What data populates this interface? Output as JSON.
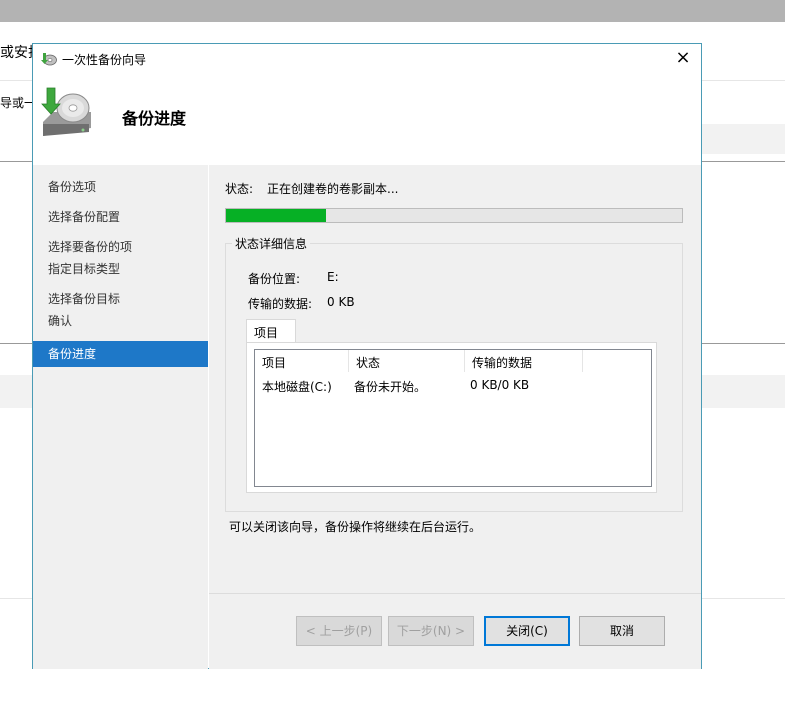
{
  "background": {
    "text1": "或安抖",
    "text2": "导或一"
  },
  "dialog": {
    "window_title": "一次性备份向导",
    "close_glyph": "×",
    "header_title": "备份进度"
  },
  "sidebar": {
    "items": [
      {
        "label": "备份选项"
      },
      {
        "label": "选择备份配置"
      },
      {
        "label": "选择要备份的项"
      },
      {
        "label": "指定目标类型"
      },
      {
        "label": "选择备份目标"
      },
      {
        "label": "确认"
      },
      {
        "label": "备份进度",
        "active": true
      }
    ]
  },
  "status": {
    "label": "状态:",
    "value": "正在创建卷的卷影副本...",
    "progress": 0.22
  },
  "details": {
    "legend": "状态详细信息",
    "location_label": "备份位置:",
    "location_value": "E:",
    "transferred_label": "传输的数据:",
    "transferred_value": "0 KB",
    "tab_label": "项目",
    "columns": [
      "项目",
      "状态",
      "传输的数据"
    ],
    "rows": [
      {
        "item": "本地磁盘(C:)",
        "status": "备份未开始。",
        "data": "0 KB/0 KB"
      }
    ]
  },
  "note": "可以关闭该向导，备份操作将继续在后台运行。",
  "buttons": {
    "back": "< 上一步(P)",
    "next": "下一步(N) >",
    "close": "关闭(C)",
    "cancel": "取消"
  },
  "colors": {
    "accent": "#1e78c8",
    "progress": "#06b025",
    "border": "#4a9bb5"
  }
}
